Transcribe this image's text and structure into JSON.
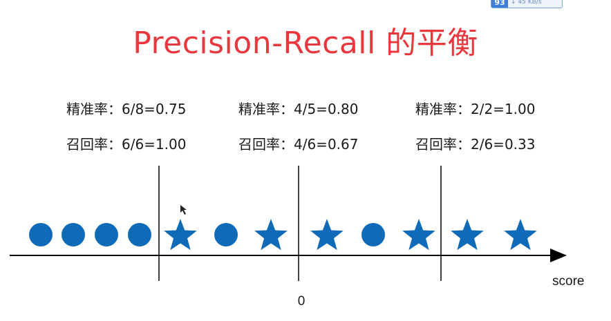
{
  "widget": {
    "badge": "93",
    "speed": "↓ 45 KB/s"
  },
  "title": "Precision-Recall 的平衡",
  "metrics": [
    {
      "precision": "精准率：6/8=0.75",
      "recall": "召回率：6/6=1.00"
    },
    {
      "precision": "精准率：4/5=0.80",
      "recall": "召回率：4/6=0.67"
    },
    {
      "precision": "精准率：2/2=1.00",
      "recall": "召回率：2/6=0.33"
    }
  ],
  "axis": {
    "label": "score",
    "zero": "0"
  },
  "samples": [
    "circle",
    "circle",
    "circle",
    "circle",
    "star",
    "circle",
    "star",
    "star",
    "circle",
    "star",
    "star",
    "star"
  ],
  "thresholds_after_sample_index": [
    3,
    7,
    9
  ],
  "colors": {
    "title": "#e8383d",
    "marker": "#0f6bb8",
    "text": "#1a1a1a"
  }
}
